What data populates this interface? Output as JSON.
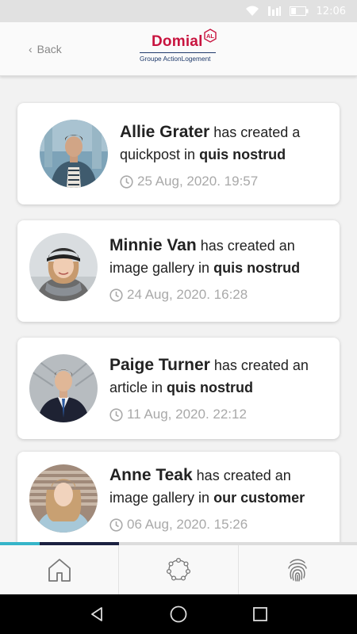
{
  "status_bar": {
    "time": "12:06"
  },
  "header": {
    "back_label": "Back",
    "brand": "Domial",
    "brand_badge": "AL",
    "brand_subtitle": "Groupe ActionLogement"
  },
  "feed": [
    {
      "name": "Allie Grater",
      "action": "has created a quickpost in",
      "target": "quis nostrud",
      "timestamp": "25 Aug, 2020. 19:57"
    },
    {
      "name": "Minnie Van",
      "action": "has created an image gallery in",
      "target": "quis nostrud",
      "timestamp": "24 Aug, 2020. 16:28"
    },
    {
      "name": "Paige Turner",
      "action": "has created an article in",
      "target": "quis nostrud",
      "timestamp": "11 Aug, 2020. 22:12"
    },
    {
      "name": "Anne Teak",
      "action": "has created an image gallery in",
      "target": "our customer",
      "timestamp": "06 Aug, 2020. 15:26"
    }
  ],
  "bottom_nav": [
    {
      "icon": "home-icon"
    },
    {
      "icon": "network-icon"
    },
    {
      "icon": "fingerprint-icon"
    }
  ],
  "colors": {
    "brand": "#c8143f",
    "brand_navy": "#1f3a6b",
    "accent": "#36b5c9"
  }
}
